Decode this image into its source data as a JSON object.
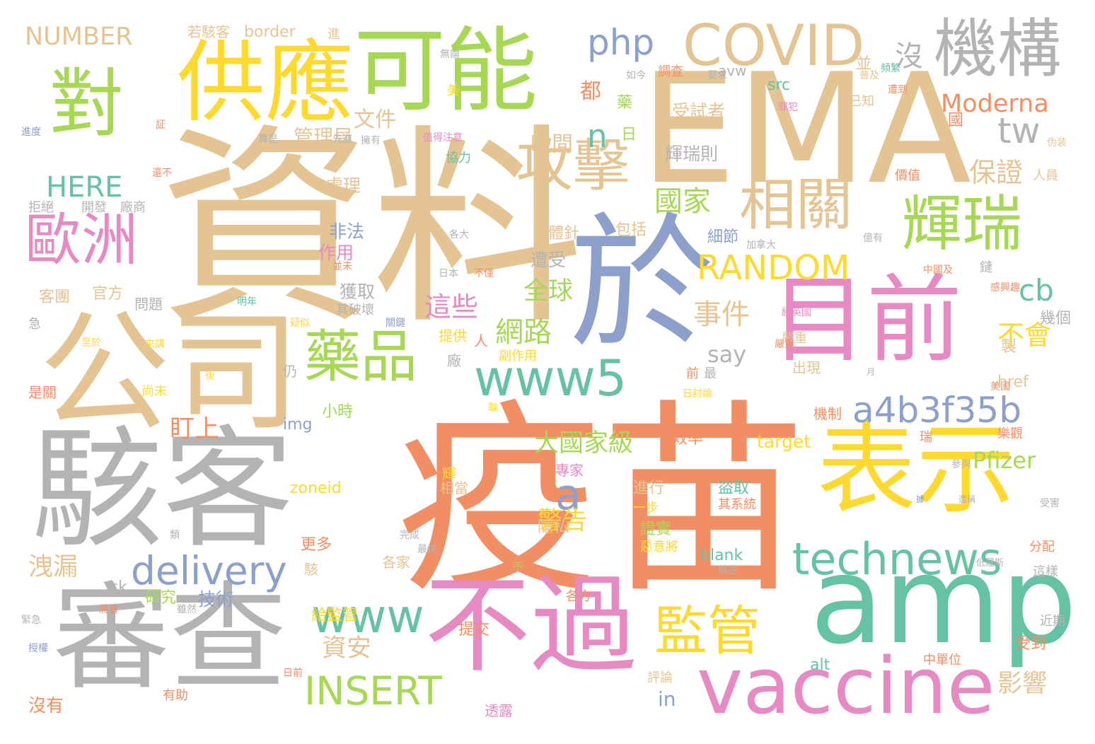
{
  "palette": {
    "orange": "#f28e63",
    "green": "#66c2a5",
    "blue": "#8da0cb",
    "pink": "#e78ac3",
    "lime": "#a6d854",
    "yellow": "#ffd92f",
    "tan": "#e5c494",
    "gray": "#b3b3b3"
  },
  "words": [
    "疫苗",
    "資料",
    "EMA",
    "於",
    "公司",
    "駭客",
    "審查",
    "目前",
    "表示",
    "amp",
    "不過",
    "vaccine",
    "對",
    "供應",
    "可能",
    "機構",
    "COVID",
    "攻擊",
    "相關",
    "輝瑞",
    "歐洲",
    "藥品",
    "www5",
    "technews",
    "監管",
    "www",
    "delivery",
    "a4b3f35b",
    "RANDOM",
    "INSERT",
    "php",
    "tw",
    "cb",
    "n",
    "a",
    "國家",
    "網路",
    "事件",
    "保證",
    "這些",
    "全球",
    "警告",
    "資安",
    "影響",
    "不會",
    "大國家級",
    "Moderna",
    "Pfizer",
    "HERE",
    "NUMBER",
    "洩漏",
    "盯上",
    "say",
    "沒",
    "都",
    "晚間",
    "管理局",
    "文件",
    "處理",
    "非法",
    "作用",
    "獲取",
    "遭受",
    "體針",
    "細節",
    "受試者",
    "輝瑞則",
    "沒有",
    "技術",
    "研究",
    "給監管",
    "提交",
    "透露",
    "in",
    "alt",
    "blank",
    "target",
    "img",
    "zoneid",
    "ck",
    "src",
    "border",
    "avw",
    "href",
    "若駭客",
    "進",
    "無論",
    "調查",
    "並",
    "已知",
    "頻繁",
    "遭到",
    "幾個",
    "製",
    "鏈",
    "客團",
    "官方",
    "問題",
    "急",
    "拒絕",
    "開發",
    "廠商",
    "包括",
    "隱私",
    "進行",
    "一步",
    "盜取",
    "其系統",
    "證實",
    "惡意將",
    "受到",
    "中單位",
    "分配",
    "近期",
    "這樣",
    "低羅斯",
    "月",
    "專家",
    "效率",
    "參與",
    "瑞",
    "機制",
    "出現",
    "嚴重",
    "最",
    "前",
    "各家",
    "更多",
    "駭",
    "副作用",
    "人",
    "廠",
    "提供",
    "小時",
    "相當",
    "輝",
    "美",
    "協力",
    "值得注意",
    "先進",
    "擁有",
    "算是",
    "進度",
    "証",
    "還不",
    "至於",
    "來講",
    "是關",
    "尚未",
    "仍",
    "後",
    "疑似",
    "關鍵",
    "明年",
    "其破壞",
    "日本",
    "不僅",
    "並未",
    "各大",
    "加拿大",
    "價值",
    "億有",
    "人員",
    "感興趣",
    "中國及",
    "日討論",
    "美國",
    "樂觀",
    "據",
    "遭稱",
    "國",
    "罪犯",
    "將在",
    "雖然",
    "將會",
    "緊急",
    "授權",
    "評論",
    "日前",
    "有助",
    "各方",
    "不",
    "要求",
    "如今",
    "普及",
    "伪装",
    "日",
    "藥",
    "給英國",
    "嚴重",
    "聯",
    "類",
    "完成",
    "最快",
    "受害",
    "網"
  ]
}
